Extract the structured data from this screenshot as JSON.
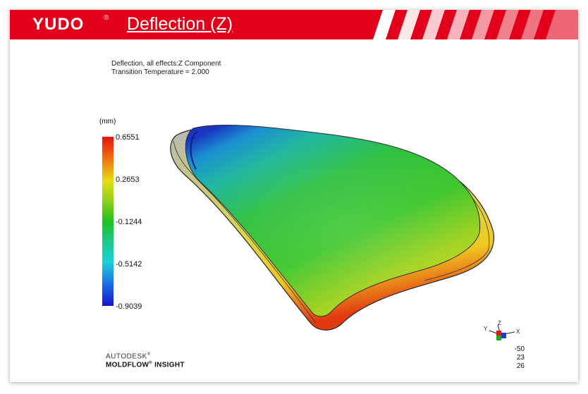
{
  "header": {
    "logo": "YUDO",
    "logo_mark": "®",
    "title": "Deflection (Z)"
  },
  "result_info": {
    "line1": "Deflection, all effects:Z Component",
    "line2": "Transition Temperature = 2.000"
  },
  "legend": {
    "unit": "(mm)",
    "ticks": [
      "0.6551",
      "0.2653",
      "-0.1244",
      "-0.5142",
      "-0.9039"
    ],
    "max": 0.6551,
    "min": -0.9039
  },
  "branding": {
    "line1": "AUTODESK",
    "line1_mark": "®",
    "line2": "MOLDFLOW",
    "line2_mark": "®",
    "line2_rest": " INSIGHT"
  },
  "view": {
    "axis_labels": [
      "Y",
      "Z",
      "X"
    ],
    "coords": [
      "-50",
      "23",
      "26"
    ]
  },
  "colors": {
    "brand_red": "#e3001b",
    "legend_max": "#e8120f",
    "legend_mid": "#1fc11f",
    "legend_min": "#1414cc"
  }
}
